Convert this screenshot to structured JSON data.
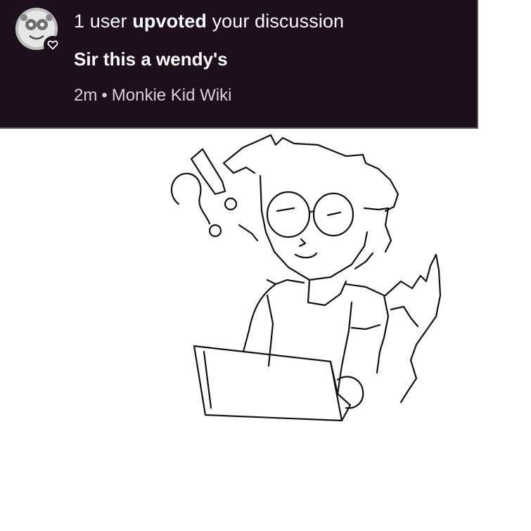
{
  "notification": {
    "count_text": "1 user",
    "action_text": "upvoted",
    "object_text": "your discussion",
    "title": "Sir this a wendy's",
    "time": "2m",
    "separator": "•",
    "community": "Monkie Kid Wiki",
    "badge_icon": "heart-icon"
  },
  "colors": {
    "banner_background": "#1e0f1d",
    "text_primary": "#ffffff",
    "text_secondary": "#d9d2d8"
  }
}
